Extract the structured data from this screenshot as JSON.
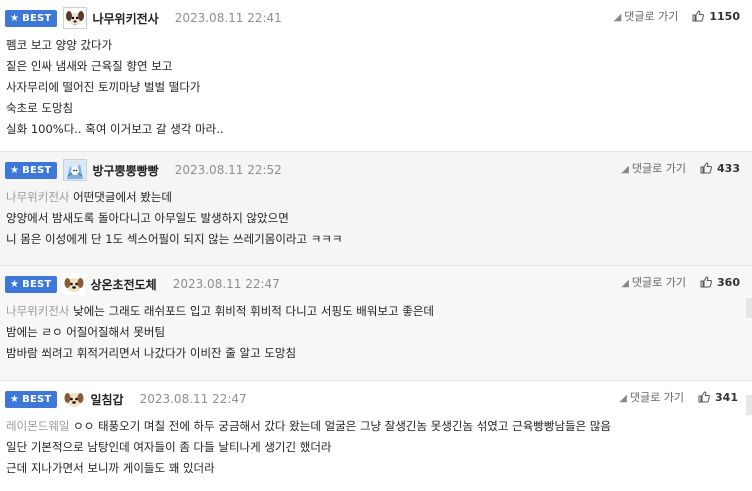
{
  "best_label": "BEST",
  "reply_label": "댓글로 가기",
  "comments": [
    {
      "nick": "나무위키전사",
      "date": "2023.08.11 22:41",
      "likes": "1150",
      "lines": [
        "펨코 보고 양양 갔다가",
        "짙은 인싸 냄새와 근육질 향연 보고",
        "사자무리에 떨어진 토끼마냥 벌벌 떨다가",
        "숙초로 도망침",
        "실화 100%다.. 혹여 이거보고 갈 생각 마라.."
      ]
    },
    {
      "nick": "방구뿡뿡빵빵",
      "date": "2023.08.11 22:52",
      "likes": "433",
      "quote": "나무위키전사",
      "lines": [
        "어떤댓글에서 봤는데",
        "양양에서 밤새도록 돌아다니고 아무일도 발생하지 않았으면",
        "니 몸은 이성에게 단 1도 섹스어필이 되지 않는 쓰레기몸이라고 ㅋㅋㅋ"
      ]
    },
    {
      "nick": "상온초전도체",
      "date": "2023.08.11 22:47",
      "likes": "360",
      "quote": "나무위키전사",
      "lines": [
        "낮에는 그래도 래쉬포드 입고 휘비적 휘비적 다니고 서핑도 배워보고 좋은데",
        "밤에는 ㄹㅇ 어질어질해서 못버팀",
        "밤바람 쐬려고 휘적거리면서 나갔다가 이비잔 줄 알고 도망침"
      ]
    },
    {
      "nick": "일침갑",
      "date": "2023.08.11 22:47",
      "likes": "341",
      "quote": "레이몬드웨일",
      "lines": [
        "ㅇㅇ 태풍오기 며칠 전에 하두 궁금해서 갔다 왔는데 얼굴은 그냥 잘생긴놈 못생긴놈 섞였고 근육빵빵남들은 많음",
        "일단 기본적으로 남탕인데 여자들이 좀 다들 날티나게 생기긴 했더라",
        "근데 지나가면서 보니까 게이들도 꽤 있더라"
      ]
    }
  ]
}
